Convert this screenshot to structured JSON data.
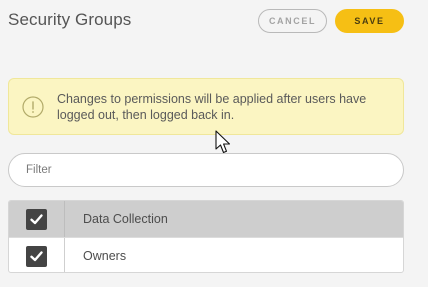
{
  "header": {
    "title": "Security Groups",
    "cancel_label": "CANCEL",
    "save_label": "SAVE"
  },
  "alert": {
    "icon": "info-circle-icon",
    "message": "Changes to permissions will be applied after users have logged out, then logged back in."
  },
  "filter": {
    "placeholder": "Filter",
    "value": ""
  },
  "groups": [
    {
      "label": "Data Collection",
      "checked": true,
      "highlighted": true
    },
    {
      "label": "Owners",
      "checked": true,
      "highlighted": false
    }
  ],
  "colors": {
    "accent": "#f6bf14",
    "alert_background": "#fbf5c2",
    "row_highlight": "#cecece",
    "checkbox": "#444444"
  }
}
